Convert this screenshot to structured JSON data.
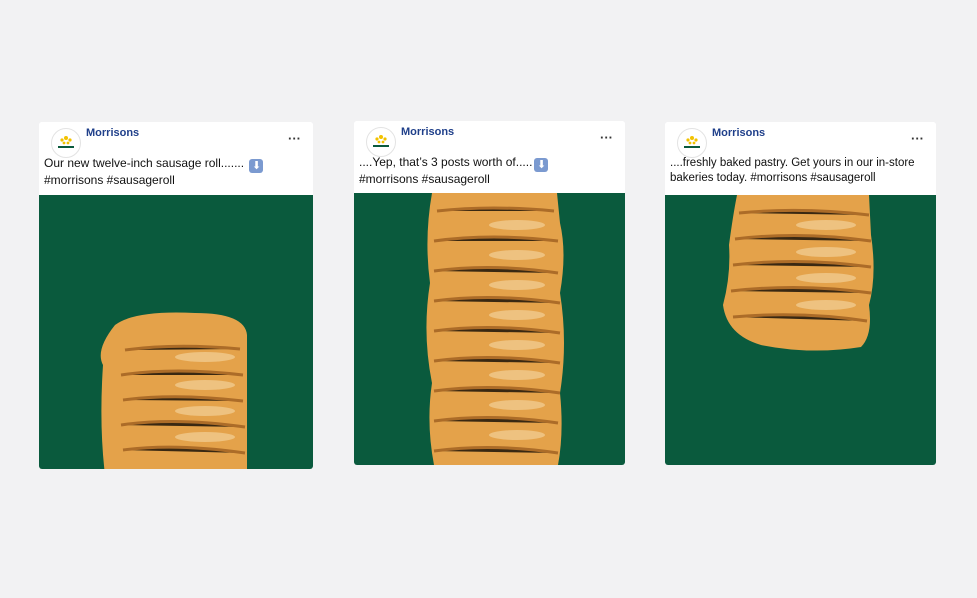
{
  "posts": [
    {
      "brand": "Morrisons",
      "more": "···",
      "caption_line1": "Our new twelve-inch sausage roll.......",
      "caption_line2": "#morrisons #sausageroll",
      "arrow": "⬇"
    },
    {
      "brand": "Morrisons",
      "more": "···",
      "caption_line1": "....Yep, that’s 3 posts worth of.....",
      "caption_line2": "#morrisons #sausageroll",
      "arrow": "⬇"
    },
    {
      "brand": "Morrisons",
      "more": "···",
      "caption_line1": "....freshly baked pastry. Get yours in our in-store",
      "caption_line2": "bakeries today. #morrisons #sausageroll",
      "arrow": ""
    }
  ],
  "colors": {
    "background": "#f2f2f3",
    "media_green": "#0a5a3d",
    "brand_blue": "#1f3f8a",
    "pastry": "#e4a24a"
  },
  "icons": {
    "avatar": "morrisons-logo-icon",
    "more": "more-options-icon",
    "arrow": "down-arrow-icon"
  }
}
